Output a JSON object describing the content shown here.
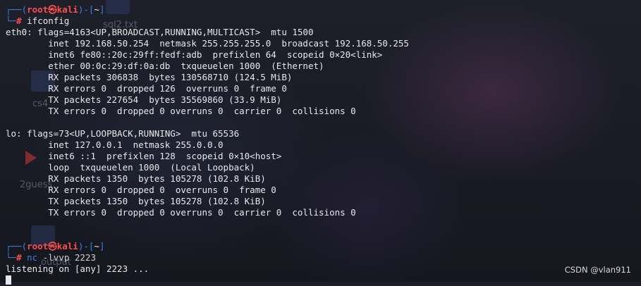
{
  "desktop": {
    "icons": [
      {
        "label": "sql2.txt"
      },
      {
        "label": "cs4"
      },
      {
        "label": "2guess"
      },
      {
        "label": "output"
      }
    ]
  },
  "prompt": {
    "corner_top": "┌──(",
    "user": "root",
    "skull": "㉿",
    "host": "kali",
    "mid": ")-[",
    "dir": "~",
    "close": "]",
    "corner_bottom": "└─",
    "hash": "#"
  },
  "session1": {
    "command": "ifconfig",
    "output": [
      "eth0: flags=4163<UP,BROADCAST,RUNNING,MULTICAST>  mtu 1500",
      "        inet 192.168.50.254  netmask 255.255.255.0  broadcast 192.168.50.255",
      "        inet6 fe80::20c:29ff:fedf:adb  prefixlen 64  scopeid 0×20<link>",
      "        ether 00:0c:29:df:0a:db  txqueuelen 1000  (Ethernet)",
      "        RX packets 306838  bytes 130568710 (124.5 MiB)",
      "        RX errors 0  dropped 126  overruns 0  frame 0",
      "        TX packets 227654  bytes 35569860 (33.9 MiB)",
      "        TX errors 0  dropped 0 overruns 0  carrier 0  collisions 0",
      "",
      "lo: flags=73<UP,LOOPBACK,RUNNING>  mtu 65536",
      "        inet 127.0.0.1  netmask 255.0.0.0",
      "        inet6 ::1  prefixlen 128  scopeid 0×10<host>",
      "        loop  txqueuelen 1000  (Local Loopback)",
      "        RX packets 1350  bytes 105278 (102.8 KiB)",
      "        RX errors 0  dropped 0  overruns 0  frame 0",
      "        TX packets 1350  bytes 105278 (102.8 KiB)",
      "        TX errors 0  dropped 0 overruns 0  carrier 0  collisions 0"
    ]
  },
  "session2": {
    "command": "nc",
    "args": " -lvvp 2223",
    "output": [
      "listening on [any] 2223 ..."
    ]
  },
  "watermark": "CSDN @vlan911",
  "colors": {
    "prompt_blue": "#3f7be0",
    "prompt_red": "#ff4d4d",
    "text": "#e8e8ea"
  }
}
